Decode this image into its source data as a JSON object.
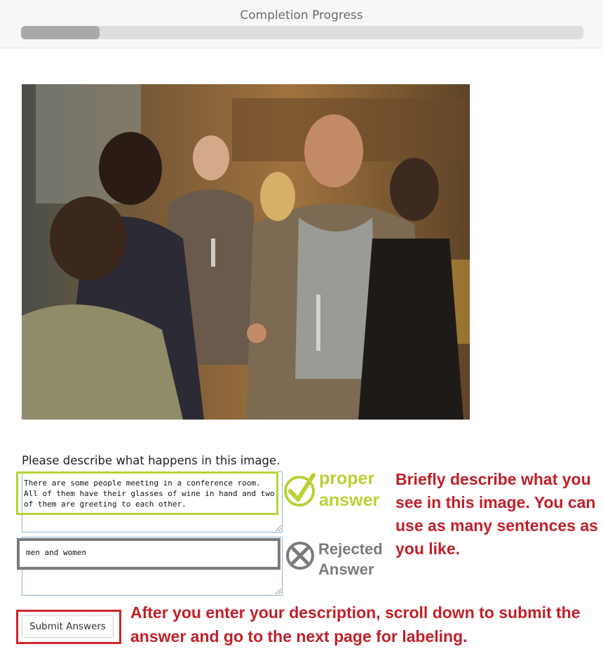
{
  "header": {
    "title": "Completion Progress",
    "progress_fraction": 0.14
  },
  "photo": {
    "subject": "people meeting in a conference room holding wine glasses"
  },
  "form": {
    "question": "Please describe what happens in this image.",
    "answer_proper": "There are some people meeting in a conference room. All of them have their glasses of wine in hand and two of them are greeting to each other.",
    "answer_rejected": "men and women",
    "submit_label": "Submit Answers"
  },
  "annotations": {
    "proper_line1": "proper",
    "proper_line2": "answer",
    "rejected_line1": "Rejected",
    "rejected_line2": "Answer",
    "right_note": "Briefly describe what you see in this image. You can use as many sentences as you like.",
    "bottom_note": "After you enter your description, scroll down to submit the answer and go to the next page for labeling."
  },
  "colors": {
    "proper": "#b5d334",
    "rejected": "#7a7a7a",
    "instruction": "#c0202a"
  }
}
